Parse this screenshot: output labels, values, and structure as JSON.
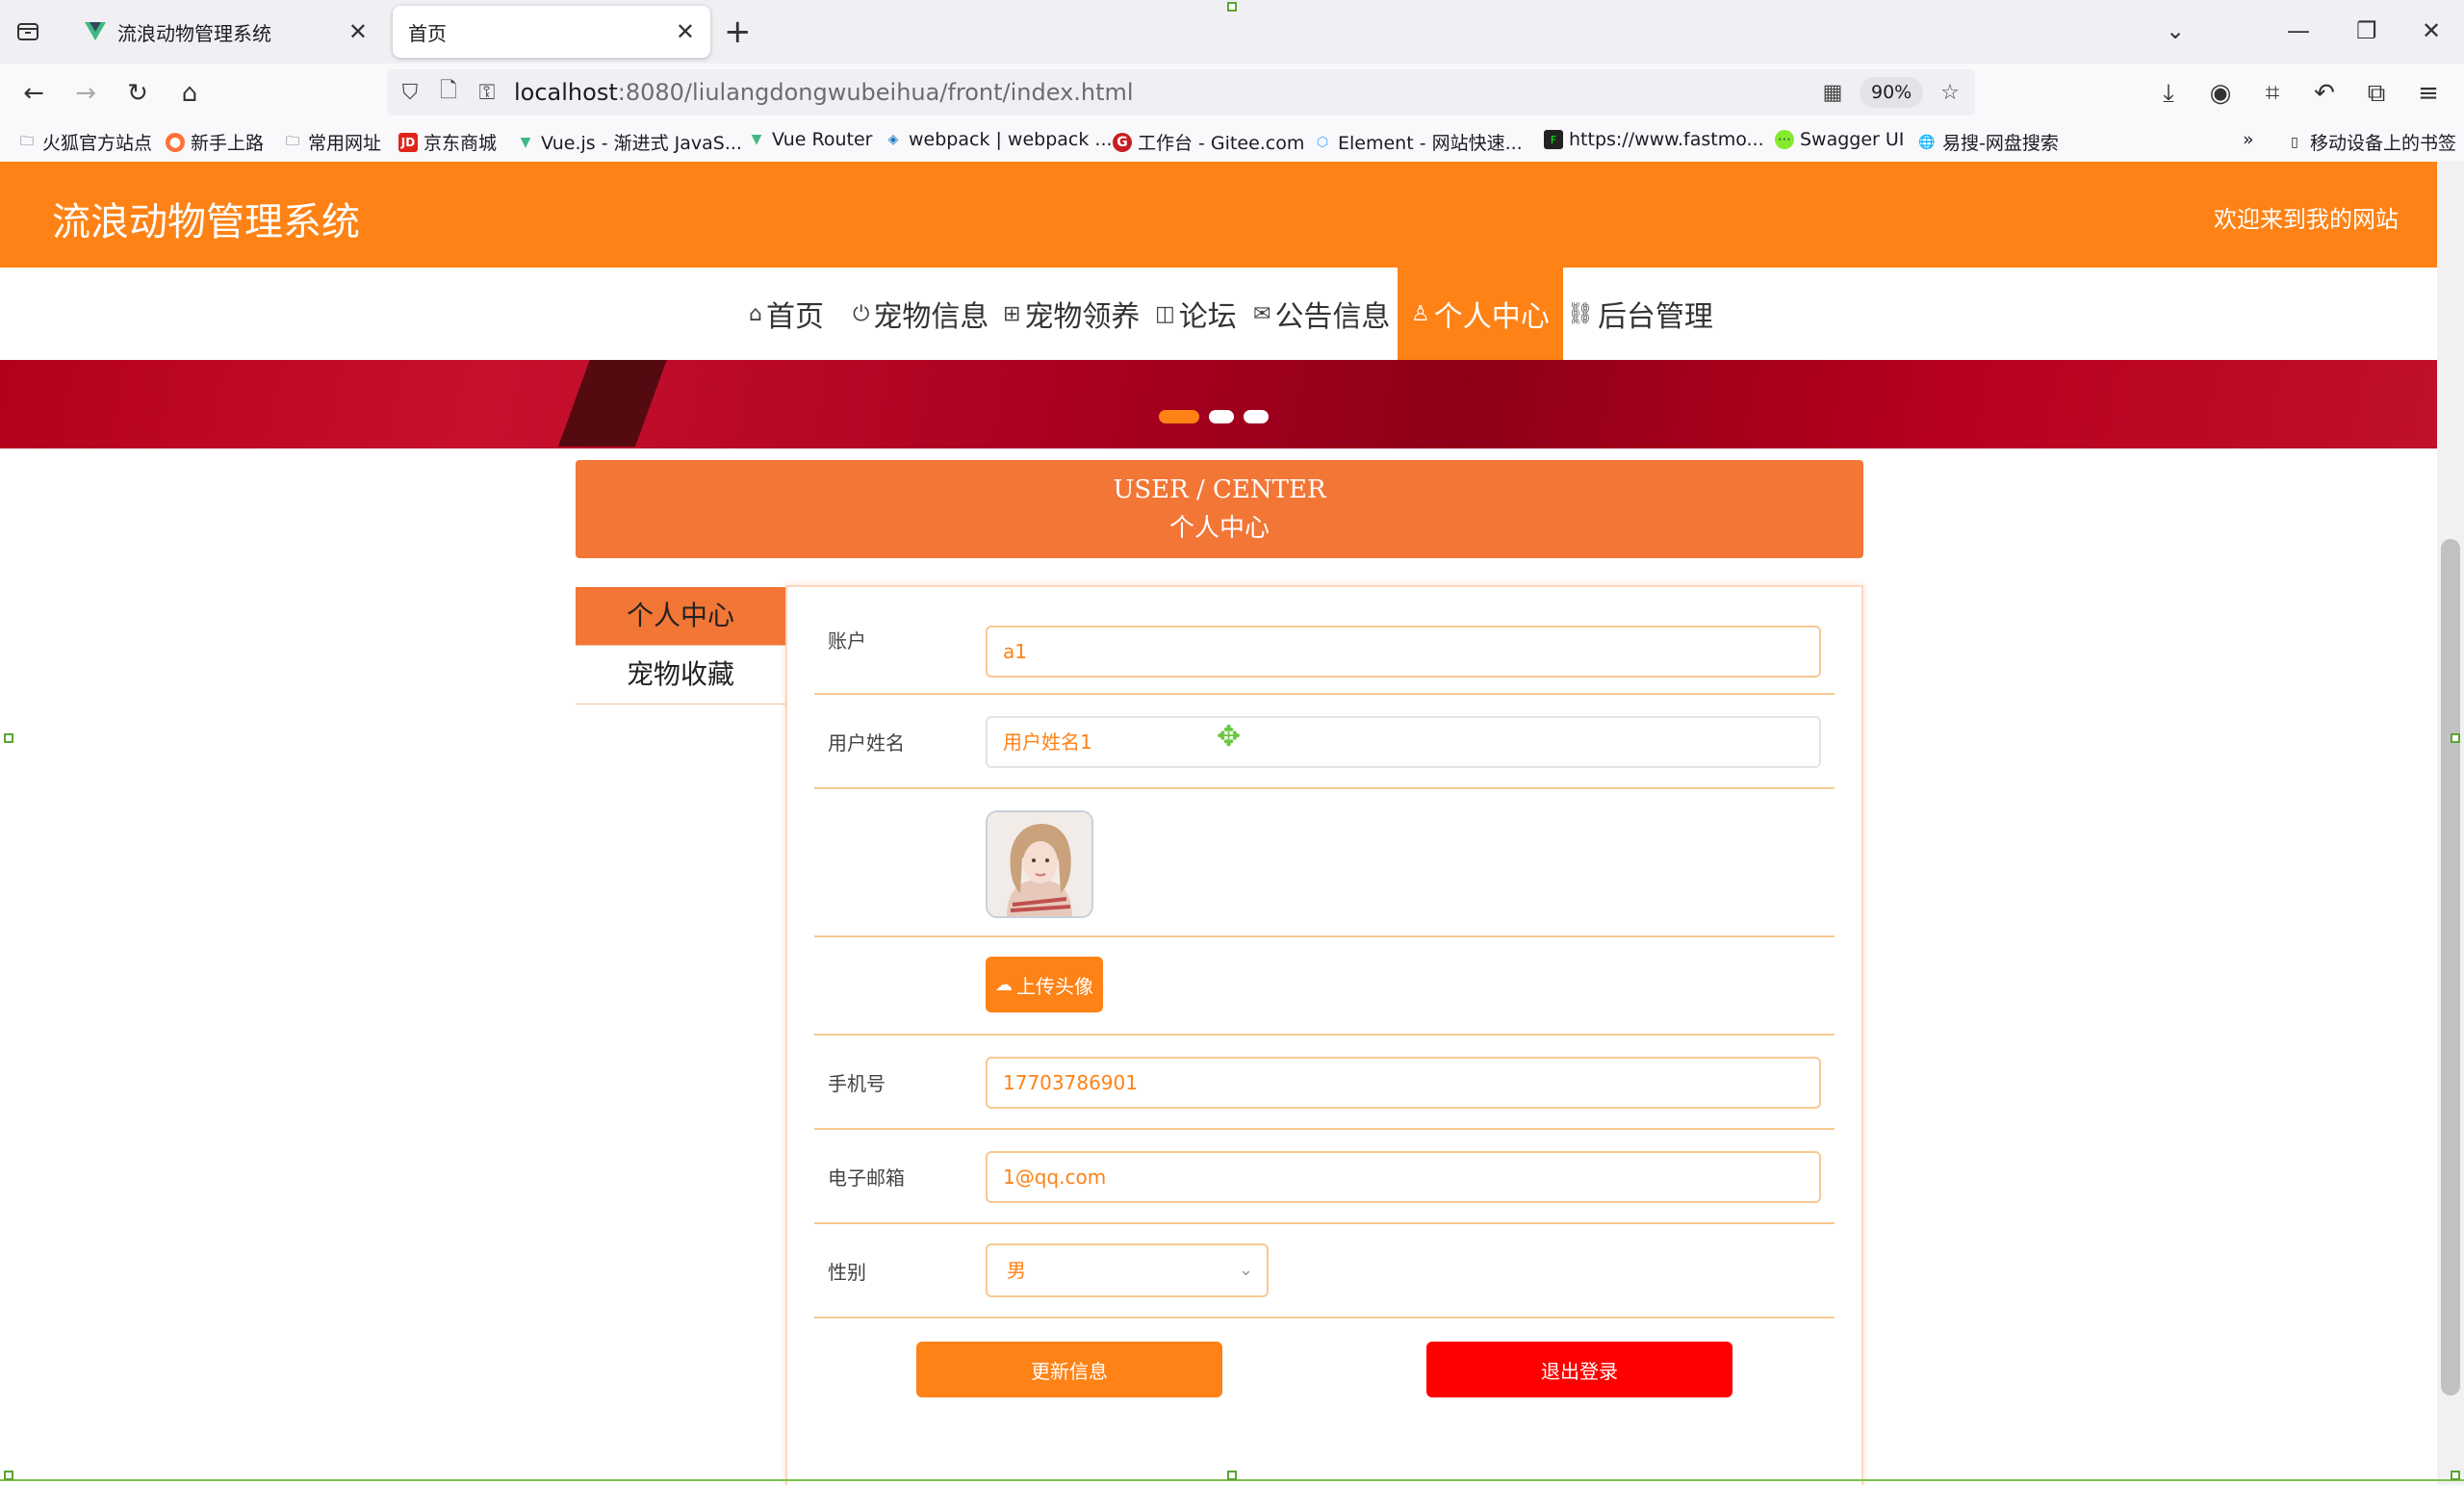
{
  "browser": {
    "tabs": [
      {
        "title": "流浪动物管理系统",
        "active": false
      },
      {
        "title": "首页",
        "active": true
      }
    ],
    "url_host": "localhost",
    "url_rest": ":8080/liulangdongwubeihua/front/index.html",
    "zoom": "90%",
    "bookmarks": [
      {
        "label": "火狐官方站点",
        "icon": "folder-icon"
      },
      {
        "label": "新手上路",
        "icon": "firefox-icon"
      },
      {
        "label": "常用网址",
        "icon": "folder-icon"
      },
      {
        "label": "京东商城",
        "icon": "jd-icon"
      },
      {
        "label": "Vue.js - 渐进式 JavaS...",
        "icon": "vue-icon"
      },
      {
        "label": "Vue Router",
        "icon": "vue-icon"
      },
      {
        "label": "webpack | webpack ...",
        "icon": "webpack-icon"
      },
      {
        "label": "工作台 - Gitee.com",
        "icon": "gitee-icon"
      },
      {
        "label": "Element - 网站快速...",
        "icon": "element-icon"
      },
      {
        "label": "https://www.fastmo...",
        "icon": "terminal-icon"
      },
      {
        "label": "Swagger UI",
        "icon": "swagger-icon"
      },
      {
        "label": "易搜-网盘搜索",
        "icon": "globe-icon"
      }
    ],
    "mobile_bookmarks": "移动设备上的书签"
  },
  "site": {
    "title": "流浪动物管理系统",
    "welcome": "欢迎来到我的网站",
    "nav": [
      {
        "label": "首页",
        "icon": "home-icon"
      },
      {
        "label": "宠物信息",
        "icon": "power-icon"
      },
      {
        "label": "宠物领养",
        "icon": "gift-icon"
      },
      {
        "label": "论坛",
        "icon": "forum-icon"
      },
      {
        "label": "公告信息",
        "icon": "mail-icon"
      },
      {
        "label": "个人中心",
        "icon": "user-icon",
        "active": true
      },
      {
        "label": "后台管理",
        "icon": "link-icon"
      }
    ]
  },
  "center": {
    "title_en": "USER / CENTER",
    "title_zh": "个人中心",
    "side_menu": [
      "个人中心",
      "宠物收藏"
    ]
  },
  "form": {
    "account": {
      "label": "账户",
      "value": "a1"
    },
    "username": {
      "label": "用户姓名",
      "value": "用户姓名1"
    },
    "upload_label": "上传头像",
    "phone": {
      "label": "手机号",
      "value": "17703786901"
    },
    "email": {
      "label": "电子邮箱",
      "value": "1@qq.com"
    },
    "gender": {
      "label": "性别",
      "value": "男"
    },
    "update_button": "更新信息",
    "logout_button": "退出登录"
  },
  "colors": {
    "primary": "#fe8215",
    "title_bar": "#f27636",
    "danger": "#ff0000"
  }
}
